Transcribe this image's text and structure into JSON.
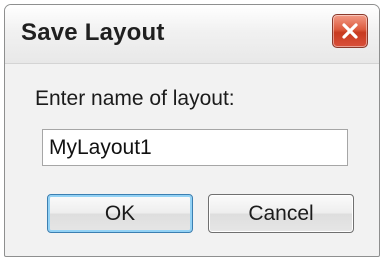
{
  "dialog": {
    "title": "Save Layout",
    "close_icon": "close-icon",
    "prompt": "Enter name of layout:",
    "input_value": "MyLayout1",
    "ok_label": "OK",
    "cancel_label": "Cancel"
  },
  "colors": {
    "close_button": "#d9503a",
    "focus_border": "#3c7fb1"
  }
}
